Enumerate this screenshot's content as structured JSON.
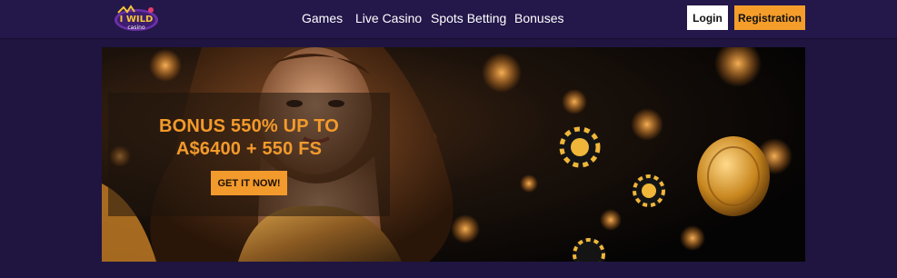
{
  "brand": {
    "logo_top": "I WILD",
    "logo_bottom": "casino"
  },
  "nav": {
    "items": [
      {
        "label": "Games"
      },
      {
        "label": "Live Casino"
      },
      {
        "label": "Spots Betting"
      },
      {
        "label": "Bonuses"
      }
    ]
  },
  "auth": {
    "login_label": "Login",
    "register_label": "Registration"
  },
  "hero": {
    "promo_line1": "BONUS 550% UP TO",
    "promo_line2": "A$6400 + 550 FS",
    "cta_label": "GET IT NOW!"
  },
  "colors": {
    "background": "#1f1540",
    "header": "#24174a",
    "accent": "#f39a2c",
    "login_bg": "#ffffff"
  }
}
